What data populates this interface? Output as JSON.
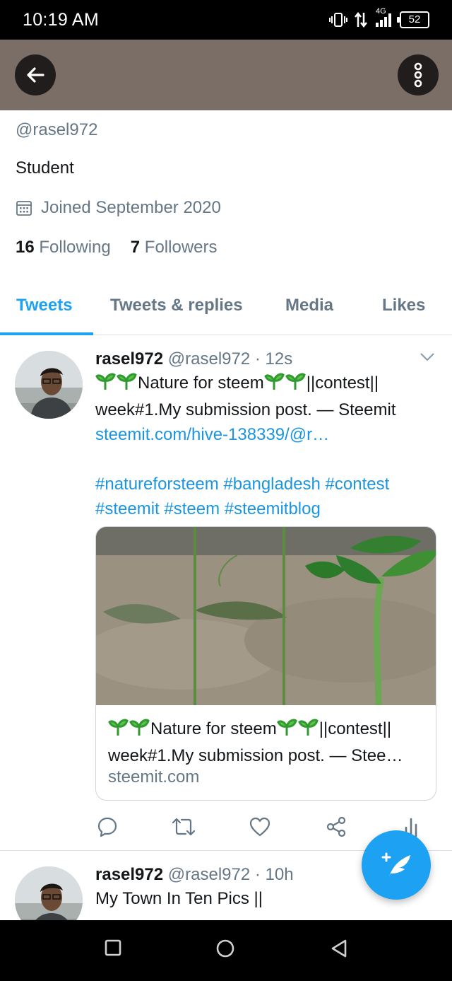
{
  "status_bar": {
    "time": "10:19 AM",
    "network": "4G",
    "battery": "52"
  },
  "header": {
    "back_icon": "arrow-left-icon",
    "more_icon": "more-vertical-icon",
    "banner_color": "#7b6e66"
  },
  "profile": {
    "handle": "@rasel972",
    "bio": "Student",
    "joined": "Joined September 2020",
    "following_count": "16",
    "following_label": "Following",
    "followers_count": "7",
    "followers_label": "Followers"
  },
  "tabs": [
    {
      "label": "Tweets",
      "active": true
    },
    {
      "label": "Tweets & replies",
      "active": false
    },
    {
      "label": "Media",
      "active": false
    },
    {
      "label": "Likes",
      "active": false
    }
  ],
  "tweets": [
    {
      "name": "rasel972",
      "meta": "@rasel972 · 12s",
      "title_part1": "Nature for steem",
      "title_part2": "||contest|| week#1.My submission post. — Steemit",
      "link": "steemit.com/hive-138339/@r…",
      "hashtags_line1": "#natureforsteem #bangladesh #contest",
      "hashtags_line2": "#steemit #steem #steemitblog",
      "card_title_part1": "Nature for steem",
      "card_title_part2": "||contest||",
      "card_title_line2": "week#1.My submission post. — Stee…",
      "card_domain": "steemit.com"
    },
    {
      "name": "rasel972",
      "meta": "@rasel972 · 10h",
      "text_line1": "My Town In Ten Pics ||"
    }
  ],
  "actions": [
    "reply-icon",
    "retweet-icon",
    "like-icon",
    "share-icon",
    "analytics-icon"
  ],
  "fab": {
    "icon": "compose-tweet-icon"
  },
  "colors": {
    "accent": "#1da1f2",
    "link": "#1b95e0",
    "muted": "#657786"
  }
}
